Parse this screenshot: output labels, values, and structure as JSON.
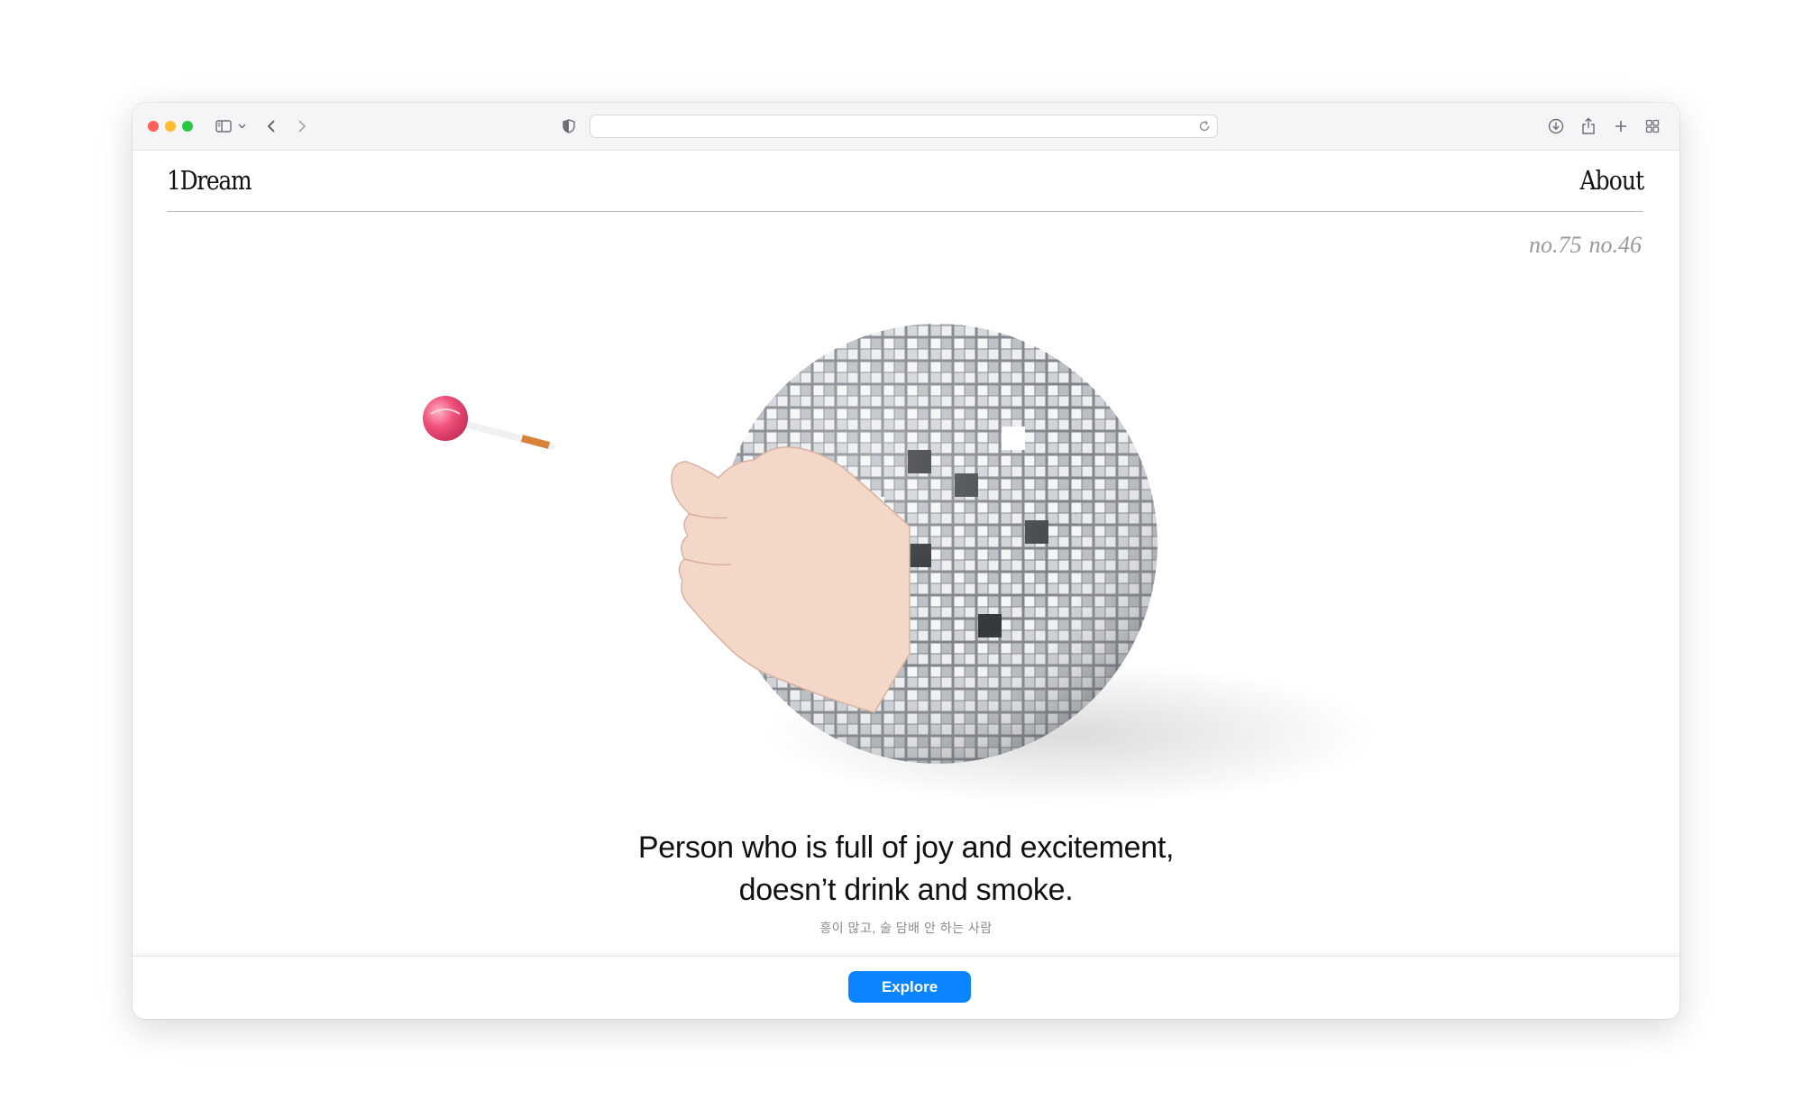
{
  "browser": {
    "url_value": "",
    "icons": [
      "sidebar-icon",
      "chevron-down-icon",
      "back-icon",
      "forward-icon",
      "shield-icon",
      "reload-icon",
      "download-icon",
      "share-icon",
      "new-tab-icon",
      "tab-overview-icon"
    ]
  },
  "site": {
    "logo": "1Dream",
    "nav_about": "About",
    "issues": [
      "no.75",
      "no.46"
    ]
  },
  "hero": {
    "image_name": "disco-ball-hand-lollipop",
    "headline_line1": "Person who is full of joy and excitement,",
    "headline_line2": "doesn’t drink and smoke.",
    "subline": "흥이 많고, 술 담배 안 하는 사람"
  },
  "footer": {
    "explore_label": "Explore"
  },
  "colors": {
    "accent": "#0a84ff",
    "lollipop": "#f0507a"
  }
}
